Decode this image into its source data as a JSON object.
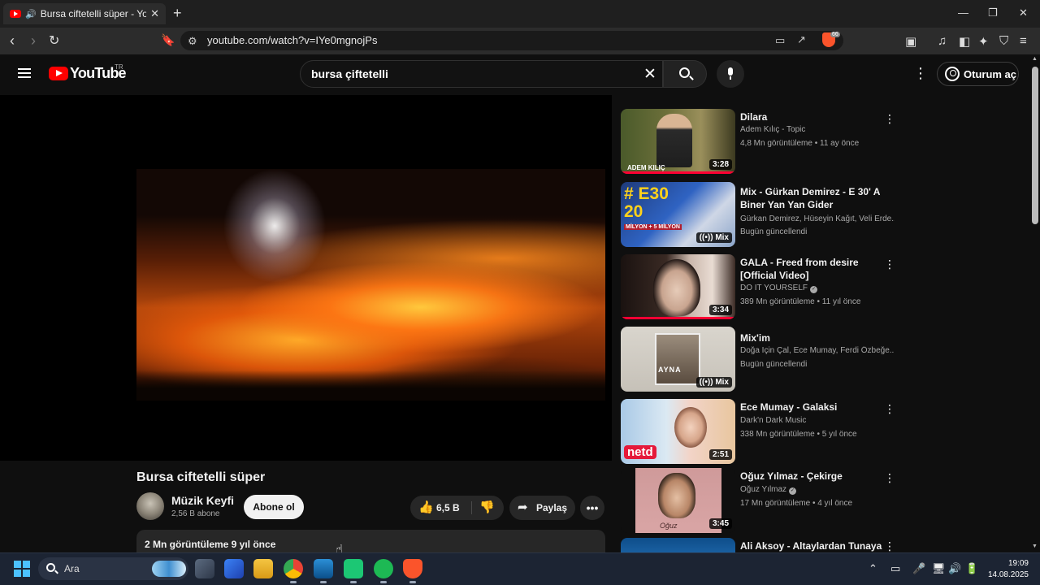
{
  "browser": {
    "tab_title": "Bursa ciftetelli süper - YouTube",
    "url": "youtube.com/watch?v=IYe0mgnojPs",
    "brave_badge": "66"
  },
  "youtube": {
    "wordmark": "YouTube",
    "region": "TR",
    "search_query": "bursa çiftetelli",
    "signin_label": "Oturum aç"
  },
  "video": {
    "title": "Bursa ciftetelli süper",
    "channel_name": "Müzik Keyfi",
    "channel_subs": "2,56 B abone",
    "subscribe_label": "Abone ol",
    "likes": "6,5 B",
    "share_label": "Paylaş",
    "description_meta": "2 Mn görüntüleme  9 yıl önce"
  },
  "recommendations": [
    {
      "title": "Dilara",
      "line1": "Adem Kılıç - Topic",
      "line2": "4,8 Mn görüntüleme • 11 ay önce",
      "badge": "3:28",
      "thumb_caption": "ADEM KILIÇ"
    },
    {
      "title": "Mix - Gürkan Demirez - E 30' A Biner Yan Yan Gider",
      "line1": "Gürkan Demirez, Hüseyin Kağıt, Veli Erde...",
      "line2": "Bugün güncellendi",
      "badge": "Mix",
      "thumb_big": "# E30\n20",
      "thumb_small": "MİLYON + 5 MİLYON"
    },
    {
      "title": "GALA - Freed from desire [Official Video]",
      "line1": "DO IT YOURSELF",
      "line2": "389 Mn görüntüleme • 11 yıl önce",
      "badge": "3:34"
    },
    {
      "title": "Mix'im",
      "line1": "Doğa İçin Çal, Ece Mumay, Ferdi Özbeğe...",
      "line2": "Bugün güncellendi",
      "badge": "Mix",
      "thumb_caption": "AYNA"
    },
    {
      "title": "Ece Mumay - Galaksi",
      "line1": "Dark'n Dark Music",
      "line2": "338 Mn görüntüleme • 5 yıl önce",
      "badge": "2:51",
      "thumb_caption": "netd"
    },
    {
      "title": "Oğuz Yılmaz - Çekirge",
      "line1": "Oğuz Yılmaz",
      "line2": "17 Mn görüntüleme • 4 yıl önce",
      "badge": "3:45",
      "thumb_caption": "Oğuz"
    },
    {
      "title": "Ali Aksoy - Altaylardan Tunaya",
      "line1": "",
      "line2": ""
    }
  ],
  "taskbar": {
    "search_label": "Ara",
    "time": "19:09",
    "date": "14.08.2025"
  }
}
